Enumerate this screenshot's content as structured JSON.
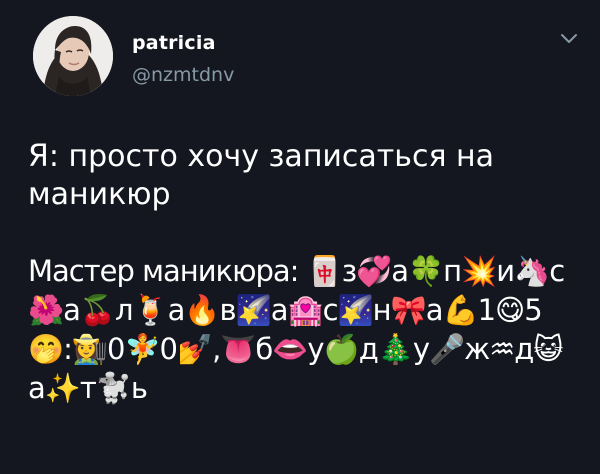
{
  "author": {
    "display_name": "patricia",
    "handle": "@nzmtdnv"
  },
  "icons": {
    "avatar": "profile-photo",
    "menu": "chevron-down-icon"
  },
  "colors": {
    "background": "#14171f",
    "text": "#ffffff",
    "muted": "#8899a6"
  },
  "tweet": {
    "line1": "Я: просто хочу записаться на маникюр",
    "line2": "Мастер маникюра: 🀄з💞а🍀п💥и🦄с🌺а🍒л🍹а🔥в🌠а🏩с🌠н🎀а💪1😋5🤭:👩‍🌾0🧚0💅,👅б👄у🍏д🎄у🎤ж♒д😺а✨т🐩ь"
  }
}
